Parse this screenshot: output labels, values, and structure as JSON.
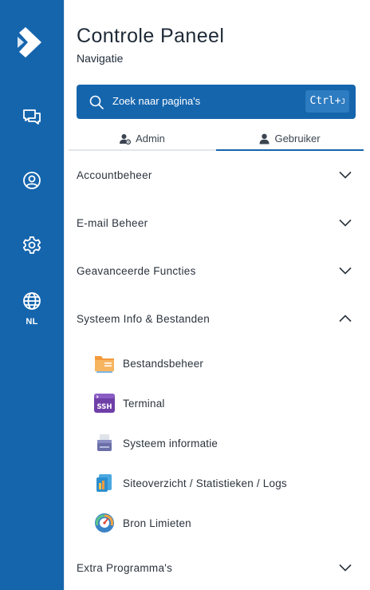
{
  "header": {
    "title": "Controle Paneel",
    "subtitle": "Navigatie"
  },
  "search": {
    "placeholder": "Zoek naar pagina's",
    "shortcut_main": "Ctrl+",
    "shortcut_key": "J"
  },
  "tabs": [
    {
      "label": "Admin",
      "icon": "user-gear-icon"
    },
    {
      "label": "Gebruiker",
      "icon": "user-icon",
      "active": true
    }
  ],
  "rail": {
    "items": [
      "chat-icon",
      "user-circle-icon",
      "gear-icon",
      "globe-icon"
    ],
    "language": "NL"
  },
  "sections": [
    {
      "label": "Accountbeheer",
      "expanded": false
    },
    {
      "label": "E-mail Beheer",
      "expanded": false
    },
    {
      "label": "Geavanceerde Functies",
      "expanded": false
    },
    {
      "label": "Systeem Info & Bestanden",
      "expanded": true
    },
    {
      "label": "Extra Programma's",
      "expanded": false
    }
  ],
  "system_items": [
    {
      "label": "Bestandsbeheer",
      "icon": "folder-icon"
    },
    {
      "label": "Terminal",
      "icon": "ssh-terminal-icon"
    },
    {
      "label": "Systeem informatie",
      "icon": "printer-icon"
    },
    {
      "label": "Siteoverzicht / Statistieken / Logs",
      "icon": "statistics-icon"
    },
    {
      "label": "Bron Limieten",
      "icon": "gauge-icon"
    }
  ],
  "colors": {
    "brand": "#1565ad",
    "text": "#1f2a37",
    "divider": "#e3e6e9"
  }
}
